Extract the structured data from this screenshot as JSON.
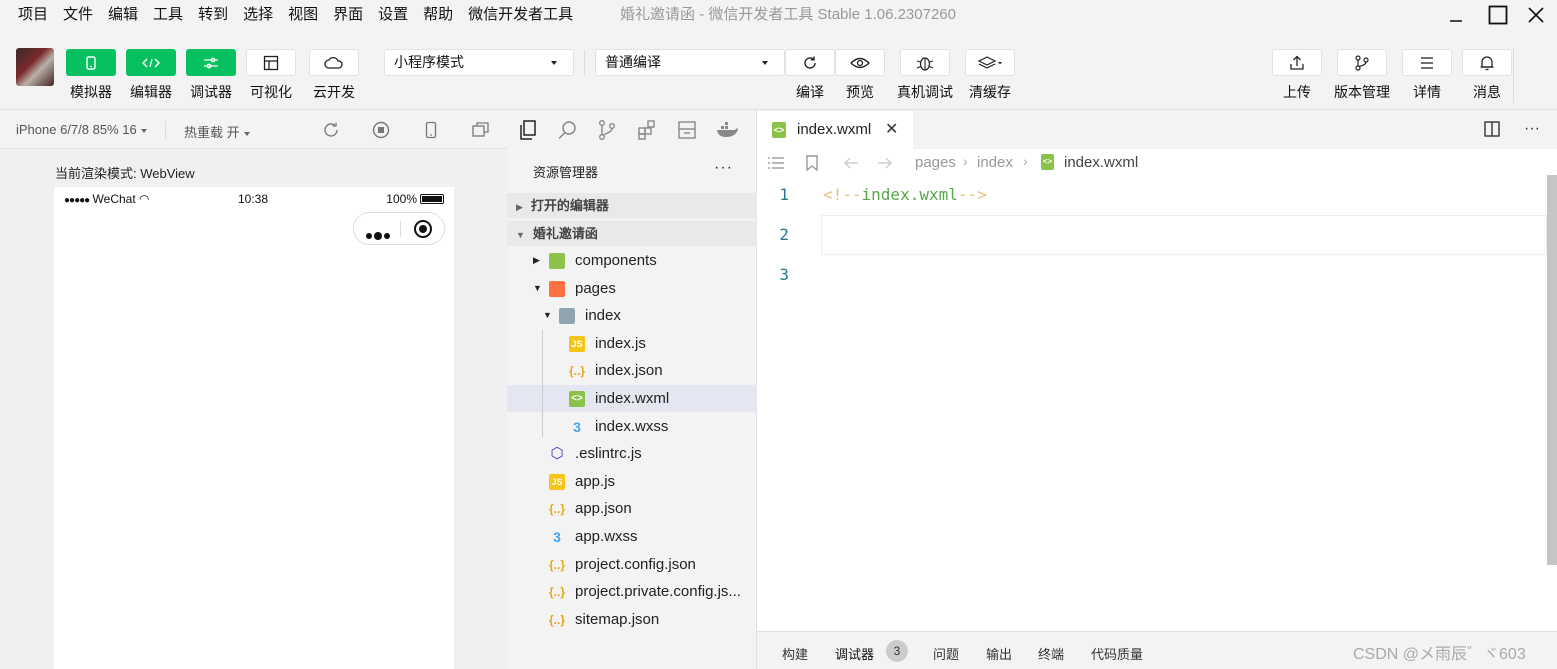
{
  "menu": {
    "items": [
      "项目",
      "文件",
      "编辑",
      "工具",
      "转到",
      "选择",
      "视图",
      "界面",
      "设置",
      "帮助",
      "微信开发者工具"
    ],
    "project_name": "婚礼邀请函",
    "app_title": "微信开发者工具 Stable 1.06.2307260"
  },
  "toolbar": {
    "left_buttons": [
      {
        "label": "模拟器",
        "icon": "phone-icon"
      },
      {
        "label": "编辑器",
        "icon": "code-icon"
      },
      {
        "label": "调试器",
        "icon": "debug-icon"
      },
      {
        "label": "可视化",
        "icon": "layout-icon"
      },
      {
        "label": "云开发",
        "icon": "cloud-icon"
      }
    ],
    "mode_select": "小程序模式",
    "compile_select": "普通编译",
    "middle_buttons": [
      {
        "label": "编译",
        "icon": "refresh-icon"
      },
      {
        "label": "预览",
        "icon": "eye-icon"
      },
      {
        "label": "真机调试",
        "icon": "bug-icon"
      },
      {
        "label": "清缓存",
        "icon": "layers-icon"
      }
    ],
    "right_buttons": [
      {
        "label": "上传",
        "icon": "upload-icon"
      },
      {
        "label": "版本管理",
        "icon": "branch-icon"
      },
      {
        "label": "详情",
        "icon": "menu-icon"
      },
      {
        "label": "消息",
        "icon": "bell-icon"
      }
    ]
  },
  "simulator": {
    "device": "iPhone 6/7/8 85% 16",
    "hot_reload": "热重载 开",
    "render_mode": "当前渲染模式: WebView",
    "status": {
      "carrier": "WeChat",
      "time": "10:38",
      "battery": "100%"
    }
  },
  "explorer": {
    "title": "资源管理器",
    "more": "···",
    "open_editors": "打开的编辑器",
    "project": "婚礼邀请函",
    "tree": [
      {
        "name": "components",
        "type": "folder-green",
        "depth": 0,
        "twisty": "▶"
      },
      {
        "name": "pages",
        "type": "folder-red",
        "depth": 0,
        "twisty": "▼"
      },
      {
        "name": "index",
        "type": "folder-grey",
        "depth": 1,
        "twisty": "▼"
      },
      {
        "name": "index.js",
        "type": "js",
        "depth": 2
      },
      {
        "name": "index.json",
        "type": "json",
        "depth": 2
      },
      {
        "name": "index.wxml",
        "type": "wxml",
        "depth": 2,
        "selected": true
      },
      {
        "name": "index.wxss",
        "type": "wxss",
        "depth": 2
      },
      {
        "name": ".eslintrc.js",
        "type": "eslint",
        "depth": 0
      },
      {
        "name": "app.js",
        "type": "js",
        "depth": 0
      },
      {
        "name": "app.json",
        "type": "json",
        "depth": 0
      },
      {
        "name": "app.wxss",
        "type": "wxss",
        "depth": 0
      },
      {
        "name": "project.config.json",
        "type": "json",
        "depth": 0
      },
      {
        "name": "project.private.config.js...",
        "type": "json",
        "depth": 0
      },
      {
        "name": "sitemap.json",
        "type": "json",
        "depth": 0
      }
    ]
  },
  "editor": {
    "tab": "index.wxml",
    "breadcrumb": [
      "pages",
      "index",
      "index.wxml"
    ],
    "lines": [
      "1",
      "2",
      "3"
    ],
    "code_line1": {
      "open": "<!--",
      "text": "index.wxml",
      "close": "-->"
    }
  },
  "bottom_panel": {
    "tabs": [
      "构建",
      "调试器",
      "问题",
      "输出",
      "终端",
      "代码质量"
    ],
    "badge": "3"
  },
  "watermark": "CSDN @メ雨辰゛ヾ603"
}
